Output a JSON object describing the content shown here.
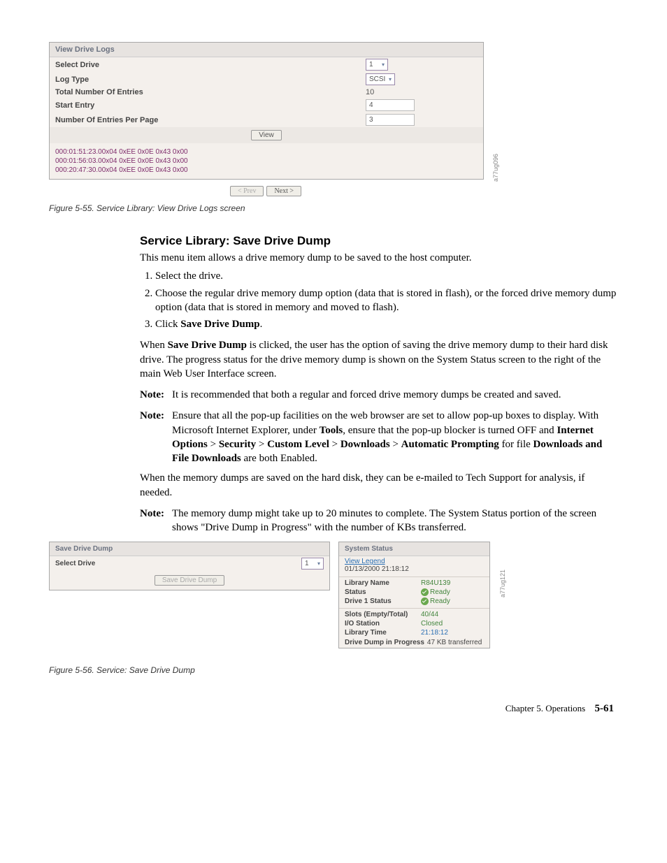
{
  "figure1": {
    "panel_title": "View Drive Logs",
    "rows": {
      "select_drive": {
        "label": "Select Drive",
        "value": "1"
      },
      "log_type": {
        "label": "Log Type",
        "value": "SCSI"
      },
      "total_entries": {
        "label": "Total Number Of Entries",
        "value": "10"
      },
      "start_entry": {
        "label": "Start Entry",
        "value": "4"
      },
      "entries_per_page": {
        "label": "Number Of Entries Per Page",
        "value": "3"
      }
    },
    "view_btn": "View",
    "logs": [
      "000:01:51:23.00x04 0xEE 0x0E 0x43 0x00",
      "000:01:56:03.00x04 0xEE 0x0E 0x43 0x00",
      "000:20:47:30.00x04 0xEE 0x0E 0x43 0x00"
    ],
    "prev_btn": "< Prev",
    "next_btn": "Next >",
    "sidecode": "a77ug096",
    "caption": "Figure 5-55. Service Library: View Drive Logs screen"
  },
  "section": {
    "heading": "Service Library: Save Drive Dump",
    "intro": "This menu item allows a drive memory dump to be saved to the host computer.",
    "steps": {
      "s1": "Select the drive.",
      "s2": "Choose the regular drive memory dump option (data that is stored in flash), or the forced drive memory dump option (data that is stored in memory and moved to flash).",
      "s3_prefix": "Click ",
      "s3_bold": "Save Drive Dump",
      "s3_suffix": "."
    },
    "para2_a": "When ",
    "para2_b": "Save Drive Dump",
    "para2_c": " is clicked, the user has the option of saving the drive memory dump to their hard disk drive. The progress status for the drive memory dump is shown on the System Status screen to the right of the main Web User Interface screen.",
    "note1_label": "Note:",
    "note1_text": "It is recommended that both a regular and forced drive memory dumps be created and saved.",
    "note2_label": "Note:",
    "note2_a": "Ensure that all the pop-up facilities on the web browser are set to allow pop-up boxes to display. With Microsoft Internet Explorer, under ",
    "note2_tools": "Tools",
    "note2_b": ", ensure that the pop-up blocker is turned OFF and ",
    "note2_io": "Internet Options",
    "note2_gt1": " > ",
    "note2_sec": "Security",
    "note2_gt2": " > ",
    "note2_cl": "Custom Level",
    "note2_gt3": " > ",
    "note2_dl": "Downloads",
    "note2_gt4": " > ",
    "note2_ap": "Automatic Prompting",
    "note2_c": " for file ",
    "note2_dfd": "Downloads and File Downloads",
    "note2_d": " are both Enabled.",
    "para3": "When the memory dumps are saved on the hard disk, they can be e-mailed to Tech Support for analysis, if needed.",
    "note3_label": "Note:",
    "note3_text": "The memory dump might take up to 20 minutes to complete. The System Status portion of the screen shows \"Drive Dump in Progress\" with the number of KBs transferred."
  },
  "figure2": {
    "left": {
      "title": "Save Drive Dump",
      "select_label": "Select Drive",
      "select_value": "1",
      "button": "Save Drive Dump"
    },
    "right": {
      "title": "System Status",
      "view_legend": "View Legend",
      "datetime": "01/13/2000 21:18:12",
      "library_name_lbl": "Library Name",
      "library_name_val": "R84U139",
      "status_lbl": "Status",
      "status_val": "Ready",
      "drive1_lbl": "Drive 1 Status",
      "drive1_val": "Ready",
      "slots_lbl": "Slots (Empty/Total)",
      "slots_val": "40/44",
      "io_lbl": "I/O Station",
      "io_val": "Closed",
      "time_lbl": "Library Time",
      "time_val": "21:18:12",
      "progress_lbl": "Drive Dump in Progress",
      "progress_val": "47 KB transferred"
    },
    "sidecode": "a77ug121",
    "caption": "Figure 5-56. Service: Save Drive Dump"
  },
  "footer": {
    "chapter": "Chapter 5. Operations",
    "page": "5-61"
  }
}
